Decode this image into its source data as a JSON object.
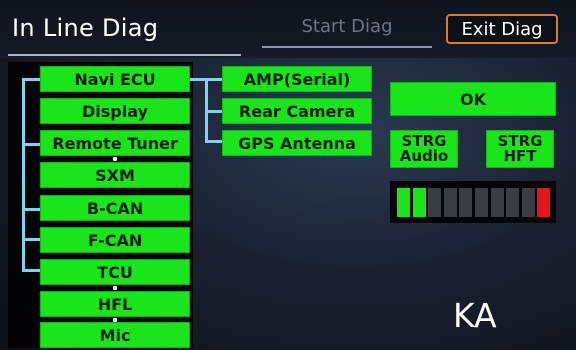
{
  "header": {
    "title": "In Line Diag",
    "start_label": "Start Diag",
    "exit_label": "Exit Diag"
  },
  "devices_left": [
    {
      "label": "Navi ECU"
    },
    {
      "label": "Display"
    },
    {
      "label": "Remote Tuner"
    },
    {
      "label": "SXM"
    },
    {
      "label": "B-CAN"
    },
    {
      "label": "F-CAN"
    },
    {
      "label": "TCU"
    },
    {
      "label": "HFL"
    },
    {
      "label": "Mic"
    }
  ],
  "devices_right": [
    {
      "label": "AMP(Serial)"
    },
    {
      "label": "Rear Camera"
    },
    {
      "label": "GPS Antenna"
    }
  ],
  "actions": {
    "ok_label": "OK",
    "strg_audio_label": "STRG\nAudio",
    "strg_hft_label": "STRG\nHFT"
  },
  "level_meter": {
    "segments_total": 10,
    "segment_states": [
      "green",
      "green",
      "off",
      "off",
      "off",
      "off",
      "off",
      "off",
      "off",
      "red"
    ],
    "colors": {
      "green": "#19e619",
      "off": "#3a3d42",
      "red": "#e8141a"
    }
  },
  "region_code": "KA",
  "colors": {
    "button_green": "#19e619",
    "exit_border": "#e07a2e",
    "tree_line": "#7fd3f0"
  }
}
